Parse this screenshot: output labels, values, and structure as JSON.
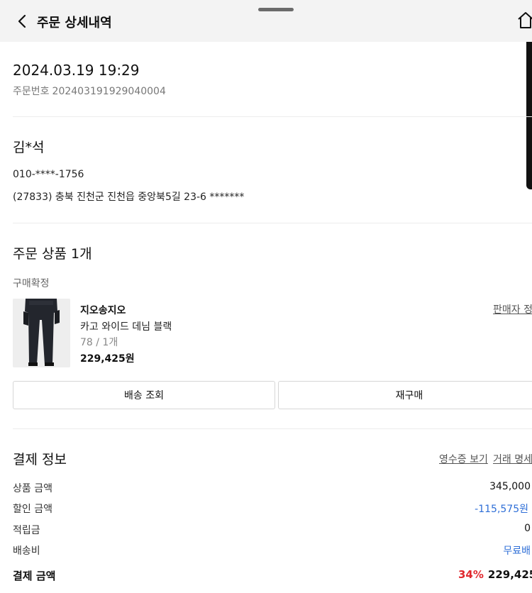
{
  "header": {
    "title": "주문 상세내역",
    "back_icon": "chevron-left-icon",
    "home_icon": "home-icon"
  },
  "order": {
    "datetime": "2024.03.19 19:29",
    "number_label": "주문번호",
    "number": "202403191929040004"
  },
  "shipping": {
    "recipient": "김*석",
    "phone": "010-****-1756",
    "address": "(27833) 충북 진천군 진천읍 중앙북5길 23-6 *******"
  },
  "items": {
    "title": "주문 상품 1개",
    "status": "구매확정",
    "product": {
      "brand": "지오송지오",
      "name": "카고 와이드 데님 블랙",
      "option": "78 / 1개",
      "price": "229,425원",
      "seller_link": "판매자 정"
    },
    "buttons": {
      "track": "배송 조회",
      "rebuy": "재구매"
    }
  },
  "payment": {
    "title": "결제 정보",
    "receipt_link": "영수증 보기",
    "transaction_link": "거래 명세",
    "rows": [
      {
        "label": "상품 금액",
        "value": "345,000"
      },
      {
        "label": "할인 금액",
        "value": "-115,575원"
      },
      {
        "label": "적립금",
        "value": "0"
      },
      {
        "label": "배송비",
        "value": "무료배"
      }
    ],
    "total_label": "결제 금액",
    "discount_percent": "34%",
    "total_value": "229,425"
  },
  "colors": {
    "accent_blue": "#2f6fd7",
    "discount_red": "#e0282e",
    "header_bg": "#f3f3f3"
  }
}
